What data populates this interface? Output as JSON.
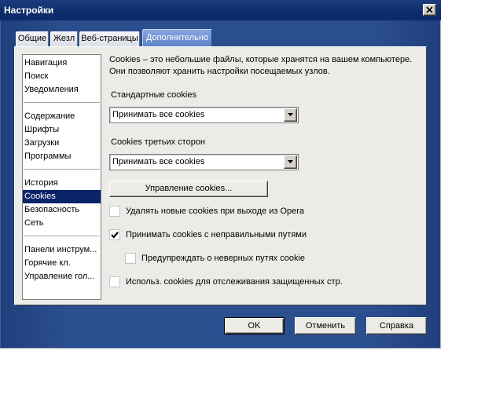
{
  "window": {
    "title": "Настройки"
  },
  "tabs": [
    {
      "label": "Общие"
    },
    {
      "label": "Жезл"
    },
    {
      "label": "Веб-страницы"
    },
    {
      "label": "Дополнительно",
      "selected": true
    }
  ],
  "sidebar": {
    "groups": [
      {
        "items": [
          {
            "label": "Навигация"
          },
          {
            "label": "Поиск"
          },
          {
            "label": "Уведомления"
          }
        ]
      },
      {
        "items": [
          {
            "label": "Содержание"
          },
          {
            "label": "Шрифты"
          },
          {
            "label": "Загрузки"
          },
          {
            "label": "Программы"
          }
        ]
      },
      {
        "items": [
          {
            "label": "История"
          },
          {
            "label": "Cookies",
            "selected": true
          },
          {
            "label": "Безопасность"
          },
          {
            "label": "Сеть"
          }
        ]
      },
      {
        "items": [
          {
            "label": "Панели инструм..."
          },
          {
            "label": "Горячие кл."
          },
          {
            "label": "Управление гол..."
          }
        ]
      }
    ]
  },
  "cookies": {
    "description": [
      "Cookies – это небольшие файлы, которые хранятся на вашем компьютере.",
      "Они позволяют хранить настройки посещаемых узлов."
    ],
    "standard": {
      "label": "Стандартные cookies",
      "value": "Принимать все cookies"
    },
    "third_party": {
      "label": "Cookies третьих сторон",
      "value": "Принимать все cookies"
    },
    "manage_button": "Управление cookies...",
    "options": [
      {
        "label": "Удалять новые cookies при выходе из Opera",
        "checked": false
      },
      {
        "label": "Принимать cookies с неправильными путями",
        "checked": true
      },
      {
        "label": "Предупреждать о неверных путях cookie",
        "checked": false
      },
      {
        "label": "Использ. cookies для отслеживания защищенных стр.",
        "checked": false
      }
    ]
  },
  "footer": {
    "ok": "OK",
    "cancel": "Отменить",
    "help": "Справка"
  },
  "icons": {
    "close": "close-icon",
    "dropdown": "chevron-down-icon",
    "checkbox": "checkmark-icon"
  },
  "colors": {
    "frame": "#2b4e8e",
    "titlebar": "#0e2b69",
    "selection": "#0a246a",
    "active_tab": "#5d82c6",
    "panel": "#ecebe7"
  }
}
